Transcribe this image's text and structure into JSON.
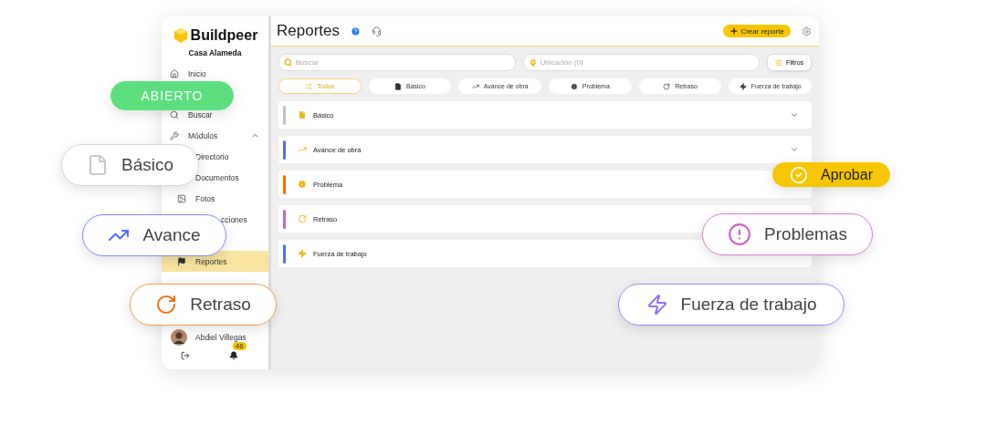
{
  "brand": {
    "name": "Buildpeer",
    "project": "Casa Alameda"
  },
  "sidebar": {
    "items": [
      {
        "label": "Inicio",
        "selected": false
      },
      {
        "label": "Buscar",
        "selected": false
      },
      {
        "label": "Módulos",
        "selected": false,
        "expanded": true,
        "children": [
          {
            "label": "Directorio",
            "selected": false
          },
          {
            "label": "Documentos",
            "selected": false
          },
          {
            "label": "Fotos",
            "selected": false
          },
          {
            "label": "cciones",
            "selected": false
          },
          {
            "label": "Reportes",
            "selected": true
          }
        ]
      }
    ],
    "user": {
      "name": "Abdiel Villegas",
      "notifications": "46"
    }
  },
  "header": {
    "title": "Reportes",
    "create_button": "Crear reporte"
  },
  "filters": {
    "search_placeholder": "Buscar",
    "location_placeholder": "Ubicación (0)",
    "filters_button": "Filtros"
  },
  "chips": [
    {
      "label": "Todos",
      "selected": true
    },
    {
      "label": "Básico",
      "selected": false
    },
    {
      "label": "Avance de obra",
      "selected": false
    },
    {
      "label": "Problema",
      "selected": false
    },
    {
      "label": "Retraso",
      "selected": false
    },
    {
      "label": "Fuerza de trabajo",
      "selected": false
    }
  ],
  "report_types": [
    {
      "label": "Básico",
      "color": "#c4c4c4"
    },
    {
      "label": "Avance de obra",
      "color": "#4f6ef7"
    },
    {
      "label": "Problema",
      "color": "#fa6a0a"
    },
    {
      "label": "Retraso",
      "color": "#c766c9"
    },
    {
      "label": "Fuerza de trabajo",
      "color": "#4f6ef7"
    }
  ],
  "callouts": [
    {
      "kind": "status",
      "label": "ABIERTO"
    },
    {
      "kind": "basic",
      "label": "Básico"
    },
    {
      "kind": "progress",
      "label": "Avance"
    },
    {
      "kind": "delay",
      "label": "Retraso"
    },
    {
      "kind": "approve",
      "label": "Aprobar"
    },
    {
      "kind": "problem",
      "label": "Problemas"
    },
    {
      "kind": "workforce",
      "label": "Fuerza de trabajo"
    }
  ]
}
